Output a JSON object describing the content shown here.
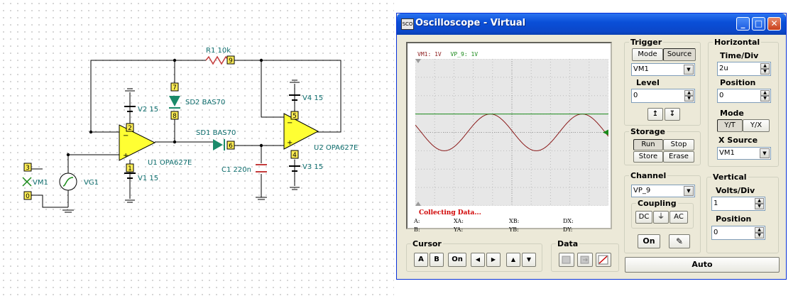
{
  "schematic": {
    "labels": {
      "r1": "R1 10k",
      "sd2": "SD2 BAS70",
      "sd1": "SD1 BAS70",
      "v2": "V2 15",
      "v1": "V1 15",
      "u1": "U1 OPA627E",
      "u2": "U2 OPA627E",
      "v4": "V4 15",
      "v3": "V3 15",
      "c1": "C1 220n",
      "vg1": "VG1",
      "vm1": "VM1"
    },
    "nodes": {
      "n9": "9",
      "n7": "7",
      "n8": "8",
      "n2": "2",
      "n1": "1",
      "n6": "6",
      "n5": "5",
      "n4": "4",
      "n3": "3",
      "n0": "0"
    }
  },
  "window": {
    "icon_text": "SCO",
    "title": "Oscilloscope - Virtual",
    "minimize": "_",
    "maximize": "□",
    "close": "✕"
  },
  "screen": {
    "ch1_label": "VM1: 1V",
    "ch2_label": "VP_9: 1V",
    "status": "Collecting Data...",
    "cursor_labels": {
      "a": "A:",
      "b": "B:",
      "xa": "XA:",
      "ya": "YA:",
      "xb": "XB:",
      "yb": "YB:",
      "dx": "DX:",
      "dy": "DY:"
    }
  },
  "trigger": {
    "title": "Trigger",
    "mode": "Mode",
    "source": "Source",
    "source_value": "VM1",
    "level_label": "Level",
    "level_value": "0",
    "rise_icon": "↥",
    "fall_icon": "↧"
  },
  "horizontal": {
    "title": "Horizontal",
    "timediv_label": "Time/Div",
    "timediv_value": "2u",
    "position_label": "Position",
    "position_value": "0",
    "mode_label": "Mode",
    "yt": "Y/T",
    "yx": "Y/X",
    "xsource_label": "X Source",
    "xsource_value": "VM1"
  },
  "storage": {
    "title": "Storage",
    "run": "Run",
    "stop": "Stop",
    "store": "Store",
    "erase": "Erase"
  },
  "channel": {
    "title": "Channel",
    "value": "VP_9",
    "coupling_label": "Coupling",
    "dc": "DC",
    "gnd": "⏚",
    "ac": "AC",
    "on": "On",
    "pen": "✎"
  },
  "vertical": {
    "title": "Vertical",
    "voltsdiv_label": "Volts/Div",
    "voltsdiv_value": "1",
    "position_label": "Position",
    "position_value": "0"
  },
  "cursor": {
    "title": "Cursor",
    "a": "A",
    "b": "B",
    "on": "On",
    "left": "◀",
    "right": "▶",
    "up": "▲",
    "down": "▼"
  },
  "data_group": {
    "title": "Data"
  },
  "auto": "Auto",
  "colors": {
    "trace1": "#8b1a1a",
    "trace2": "#1a8a1a",
    "schematic_text": "#0b6b6b",
    "node_box": "#ffee55",
    "opamp_fill": "#ffff33"
  },
  "chart_data": {
    "type": "line",
    "title": "",
    "xlabel": "",
    "ylabel": "",
    "series": [
      {
        "name": "VM1",
        "kind": "sine",
        "amplitude_div": 1.0,
        "offset_div": 0.0,
        "cycles": 2.1
      },
      {
        "name": "VP_9",
        "kind": "flat",
        "offset_div": 1.0
      }
    ],
    "grid": true,
    "divisions_x": 10,
    "divisions_y": 8
  }
}
